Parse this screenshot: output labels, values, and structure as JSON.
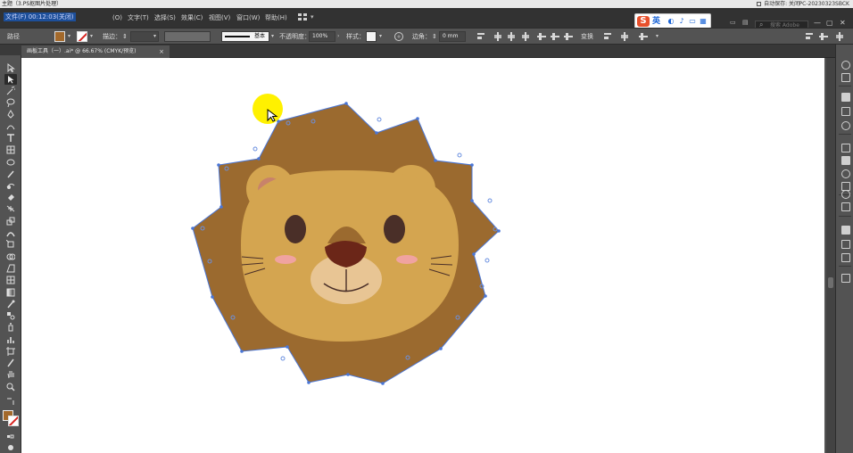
{
  "window": {
    "title": "主题（3.PS抠图片处理）",
    "autosave_text": "自动保存: 关闭",
    "pc_name": "PC-20230323SBCK"
  },
  "menu": {
    "items": [
      {
        "label": "文件(F)  00:12:03(关闭)",
        "selected": true
      },
      {
        "label": "(O)"
      },
      {
        "label": "文字(T)"
      },
      {
        "label": "选择(S)"
      },
      {
        "label": "效果(C)"
      },
      {
        "label": "视图(V)"
      },
      {
        "label": "窗口(W)"
      },
      {
        "label": "帮助(H)"
      }
    ],
    "workspace_icon": "grid-icon",
    "search_placeholder": "搜索 Adobe Stock"
  },
  "ime": {
    "brand": "S",
    "language": "英",
    "icons": [
      "moon-icon",
      "microphone-icon",
      "keyboard-icon",
      "grid-icon"
    ]
  },
  "controlbar": {
    "selection_label": "路径",
    "fill_color": "#a3692b",
    "stroke_label": "描边：",
    "stroke_profile": "基本",
    "opacity_label": "不透明度：",
    "opacity_value": "100%",
    "style_label": "样式：",
    "corner_label": "边角：",
    "corner_value": "0 mm",
    "transform_label": "变换"
  },
  "document": {
    "tab_label": "画板工具（一）.ai* @ 66.67% (CMYK/预览)",
    "close": "×"
  },
  "canvas": {
    "mane_color": "#9b6a2f",
    "face_color": "#d4a550",
    "ear_inner_color": "#c8826a",
    "muzzle_color": "#e8c594",
    "nose_color": "#6b2618",
    "eye_color": "#4a2f28",
    "blush_color": "#f0a3a0",
    "anchor_color": "#4a76d6",
    "cursor_highlight": "#fff100"
  }
}
